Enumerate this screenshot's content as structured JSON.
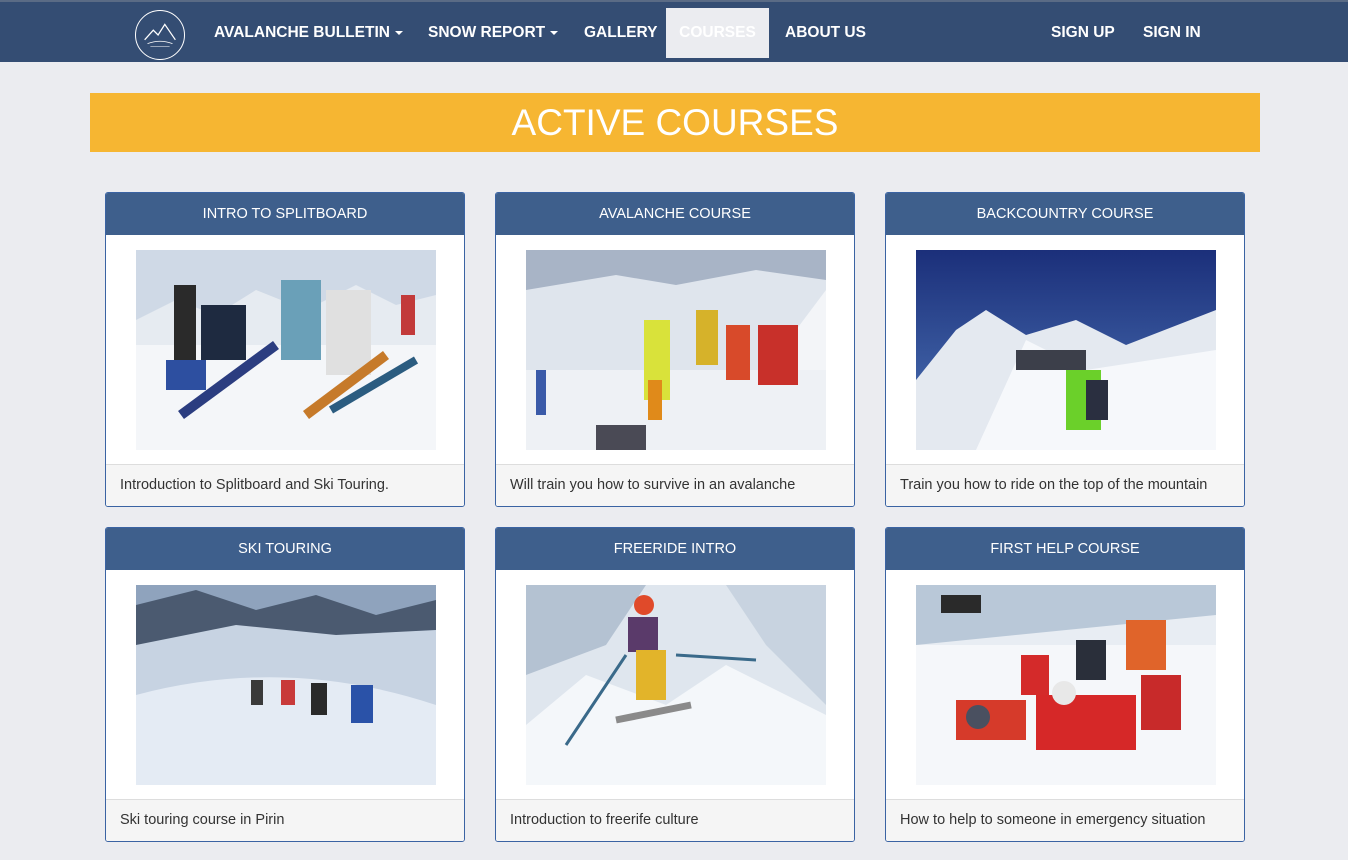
{
  "nav": {
    "logo_icon": "avalanche-mountain-logo",
    "items": [
      {
        "label": "AVALANCHE BULLETIN",
        "dropdown": true
      },
      {
        "label": "SNOW REPORT",
        "dropdown": true
      },
      {
        "label": "GALLERY",
        "dropdown": false
      },
      {
        "label": "COURSES",
        "dropdown": false,
        "active": true
      },
      {
        "label": "ABOUT US",
        "dropdown": false
      }
    ],
    "sign_up": "SIGN UP",
    "sign_in": "SIGN IN"
  },
  "banner": {
    "title": "ACTIVE COURSES"
  },
  "courses": [
    {
      "title": "INTRO TO SPLITBOARD",
      "description": "Introduction to Splitboard and Ski Touring."
    },
    {
      "title": "AVALANCHE COURSE",
      "description": "Will train you how to survive in an avalanche"
    },
    {
      "title": "BACKCOUNTRY COURSE",
      "description": "Train you how to ride on the top of the mountain"
    },
    {
      "title": "SKI TOURING",
      "description": "Ski touring course in Pirin"
    },
    {
      "title": "FREERIDE INTRO",
      "description": "Introduction to freerife culture"
    },
    {
      "title": "FIRST HELP COURSE",
      "description": "How to help to someone in emergency situation"
    }
  ],
  "colors": {
    "navbar": "#344d73",
    "banner": "#f6b632",
    "card_header": "#3e5f8c",
    "card_border": "#3a63a3",
    "page_bg": "#ebecf0"
  }
}
